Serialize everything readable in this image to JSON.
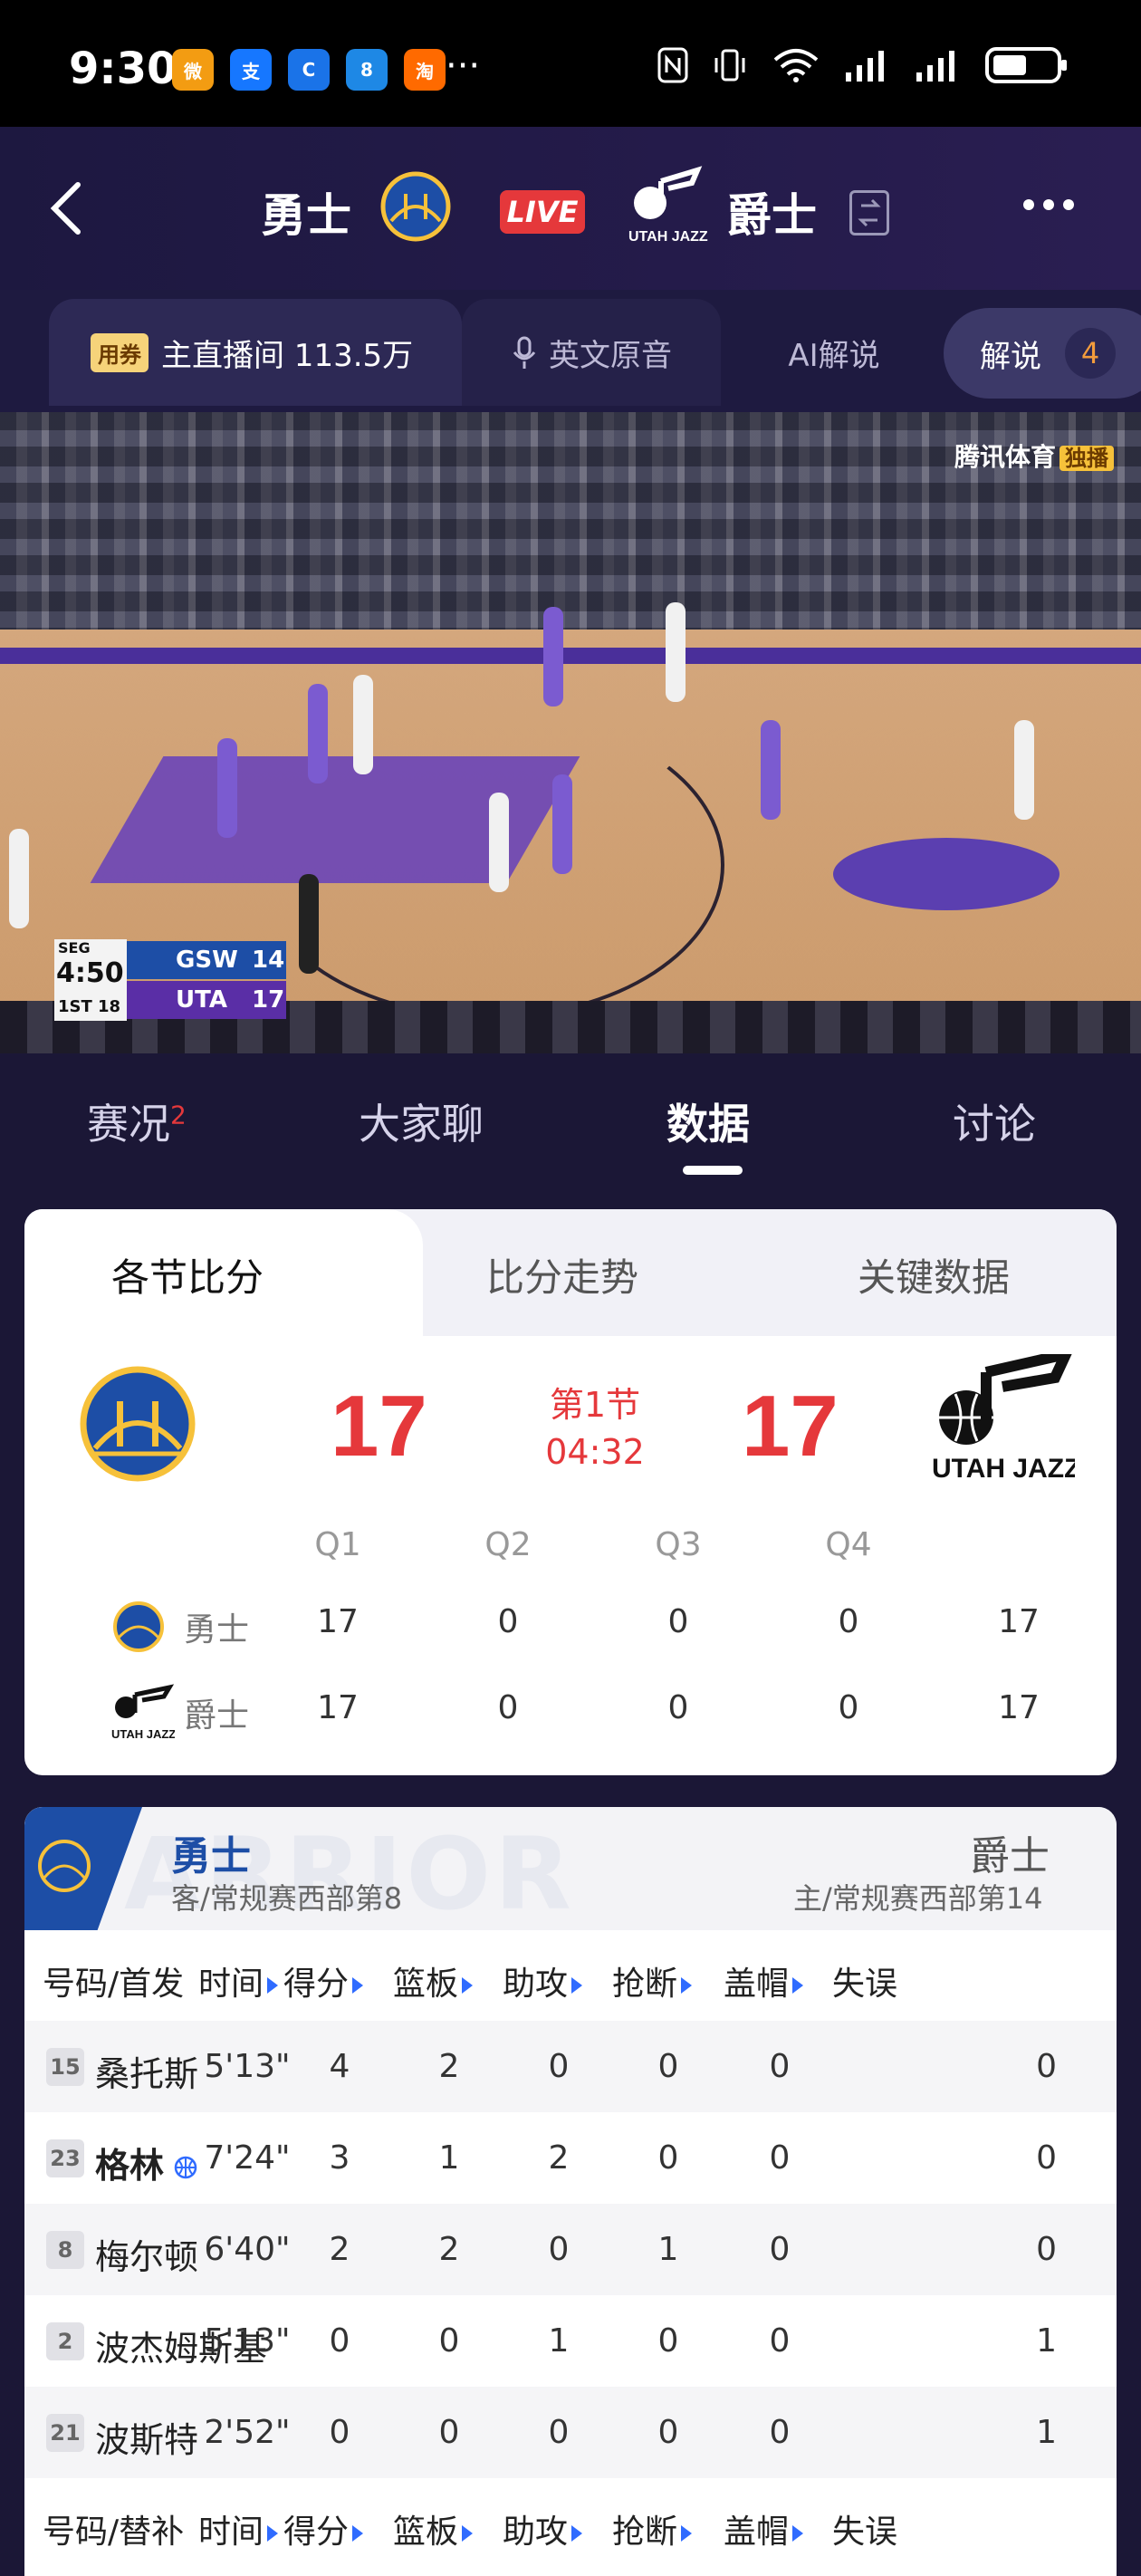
{
  "status_bar": {
    "time": "9:30",
    "more": "···",
    "app_icons": [
      {
        "name": "weibo-icon",
        "color": "#f39c12",
        "glyph": "微"
      },
      {
        "name": "alipay-icon",
        "color": "#1677ff",
        "glyph": "支"
      },
      {
        "name": "app-c-icon",
        "color": "#1a73e8",
        "glyph": "C"
      },
      {
        "name": "app-8-icon",
        "color": "#1e88e5",
        "glyph": "8"
      },
      {
        "name": "taobao-flash-icon",
        "color": "#ff6a00",
        "glyph": "淘"
      }
    ]
  },
  "header": {
    "away_team": "勇士",
    "home_team": "爵士",
    "live_label": "LIVE"
  },
  "broadcast_tabs": {
    "coupon": "用券",
    "main_room": "主直播间 113.5万",
    "english_audio": "英文原音",
    "ai_commentary": "AI解说",
    "commentary": "解说",
    "commentary_count": "4"
  },
  "video": {
    "watermark": "腾讯体育",
    "watermark_tag": "独播",
    "scorebug": {
      "venue": "SEG",
      "clock": "4:50",
      "quarter": "1ST 18",
      "away_abbr": "GSW",
      "away_pts": "14",
      "home_abbr": "UTA",
      "home_pts": "17"
    }
  },
  "content_tabs": {
    "game_status": "赛况",
    "game_status_badge": "2",
    "chat": "大家聊",
    "data": "数据",
    "discuss": "讨论"
  },
  "score_card": {
    "subtabs": [
      "各节比分",
      "比分走势",
      "关键数据"
    ],
    "away_score": "17",
    "home_score": "17",
    "period": "第1节",
    "clock": "04:32",
    "quarters": [
      "Q1",
      "Q2",
      "Q3",
      "Q4"
    ],
    "rows": [
      {
        "team": "勇士",
        "q": [
          "17",
          "0",
          "0",
          "0"
        ],
        "total": "17"
      },
      {
        "team": "爵士",
        "q": [
          "17",
          "0",
          "0",
          "0"
        ],
        "total": "17"
      }
    ]
  },
  "player_stats": {
    "away_team": "勇士",
    "away_sub": "客/常规赛西部第8",
    "home_team": "爵士",
    "home_sub": "主/常规赛西部第14",
    "bg_text": "ARRIOR",
    "starters_label": "号码/首发",
    "bench_label": "号码/替补",
    "columns": [
      "时间",
      "得分",
      "篮板",
      "助攻",
      "抢断",
      "盖帽",
      "失误"
    ],
    "starters": [
      {
        "num": "15",
        "name": "桑托斯",
        "time": "5'13\"",
        "pts": "4",
        "reb": "2",
        "ast": "0",
        "stl": "0",
        "blk": "0",
        "to": "0"
      },
      {
        "num": "23",
        "name": "格林",
        "time": "7'24\"",
        "pts": "3",
        "reb": "1",
        "ast": "2",
        "stl": "0",
        "blk": "0",
        "to": "0"
      },
      {
        "num": "8",
        "name": "梅尔顿",
        "time": "6'40\"",
        "pts": "2",
        "reb": "2",
        "ast": "0",
        "stl": "1",
        "blk": "0",
        "to": "0"
      },
      {
        "num": "2",
        "name": "波杰姆斯基",
        "time": "5'13\"",
        "pts": "0",
        "reb": "0",
        "ast": "1",
        "stl": "0",
        "blk": "0",
        "to": "1"
      },
      {
        "num": "21",
        "name": "波斯特",
        "time": "2'52\"",
        "pts": "0",
        "reb": "0",
        "ast": "0",
        "stl": "0",
        "blk": "0",
        "to": "1"
      }
    ]
  },
  "colors": {
    "accent_red": "#e5383b",
    "warriors_blue": "#1d4ea6",
    "background": "#1b1736"
  }
}
